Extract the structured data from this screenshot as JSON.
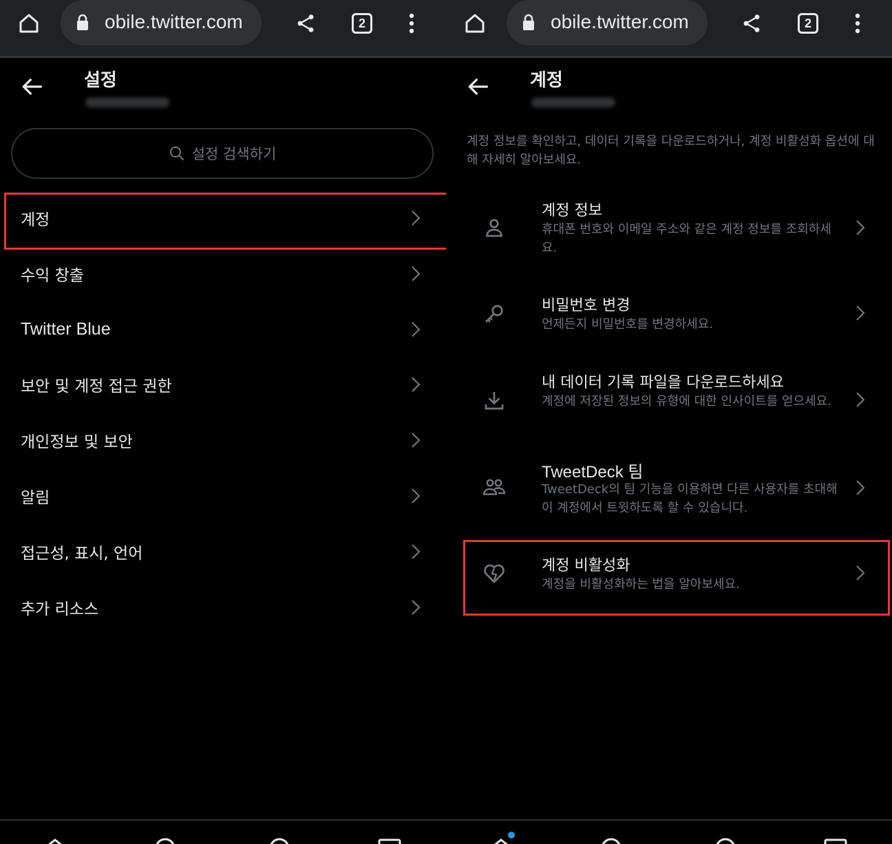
{
  "browser": {
    "url": "obile.twitter.com",
    "tab_count": "2"
  },
  "settings_page": {
    "title": "설정",
    "search_placeholder": "설정 검색하기",
    "items": [
      {
        "label": "계정"
      },
      {
        "label": "수익 창출"
      },
      {
        "label": "Twitter Blue"
      },
      {
        "label": "보안 및 계정 접근 권한"
      },
      {
        "label": "개인정보 및 보안"
      },
      {
        "label": "알림"
      },
      {
        "label": "접근성, 표시, 언어"
      },
      {
        "label": "추가 리소스"
      }
    ],
    "highlighted_item": "계정"
  },
  "account_page": {
    "title": "계정",
    "description": "계정 정보를 확인하고, 데이터 기록을 다운로드하거나, 계정 비활성화 옵션에 대해 자세히 알아보세요.",
    "items": [
      {
        "title": "계정 정보",
        "subtitle": "휴대폰 번호와 이메일 주소와 같은 계정 정보를 조회하세요.",
        "icon": "person-icon"
      },
      {
        "title": "비밀번호 변경",
        "subtitle": "언제든지 비밀번호를 변경하세요.",
        "icon": "key-icon"
      },
      {
        "title": "내 데이터 기록 파일을 다운로드하세요",
        "subtitle": "계정에 저장된 정보의 유형에 대한 인사이트를 얻으세요.",
        "icon": "download-icon"
      },
      {
        "title": "TweetDeck 팀",
        "subtitle": "TweetDeck의 팀 기능을 이용하면 다른 사용자를 초대해 이 계정에서 트윗하도록 할 수 있습니다.",
        "icon": "people-icon"
      },
      {
        "title": "계정 비활성화",
        "subtitle": "계정을 비활성화하는 법을 알아보세요.",
        "icon": "broken-heart-icon"
      }
    ],
    "highlighted_item": "계정 비활성화"
  },
  "colors": {
    "background": "#000000",
    "text_primary": "#e7e9ea",
    "text_secondary": "#71767b",
    "highlight_border": "#e53935",
    "browser_bar": "#202124",
    "accent_blue": "#1d9bf0"
  }
}
